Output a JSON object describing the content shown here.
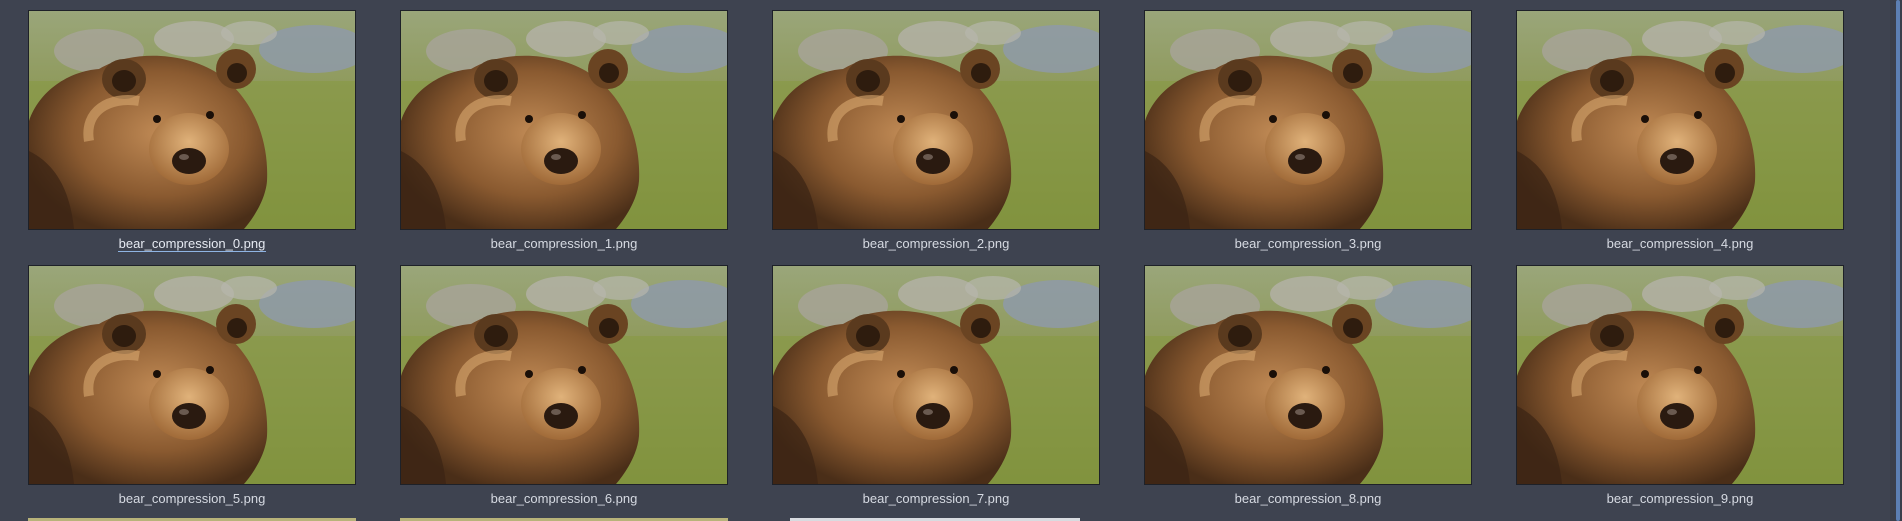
{
  "file_view": {
    "items": [
      {
        "filename": "bear_compression_0.png",
        "selected": true
      },
      {
        "filename": "bear_compression_1.png"
      },
      {
        "filename": "bear_compression_2.png"
      },
      {
        "filename": "bear_compression_3.png"
      },
      {
        "filename": "bear_compression_4.png"
      },
      {
        "filename": "bear_compression_5.png"
      },
      {
        "filename": "bear_compression_6.png"
      },
      {
        "filename": "bear_compression_7.png"
      },
      {
        "filename": "bear_compression_8.png"
      },
      {
        "filename": "bear_compression_9.png"
      }
    ],
    "thumbnail_subject": "brown bear in grass",
    "colors": {
      "background": "#3e4350",
      "label_text": "#d6dae2",
      "selection_underline": "#8fb4e3",
      "scrollbar_thumb": "#5c7fb3"
    }
  }
}
